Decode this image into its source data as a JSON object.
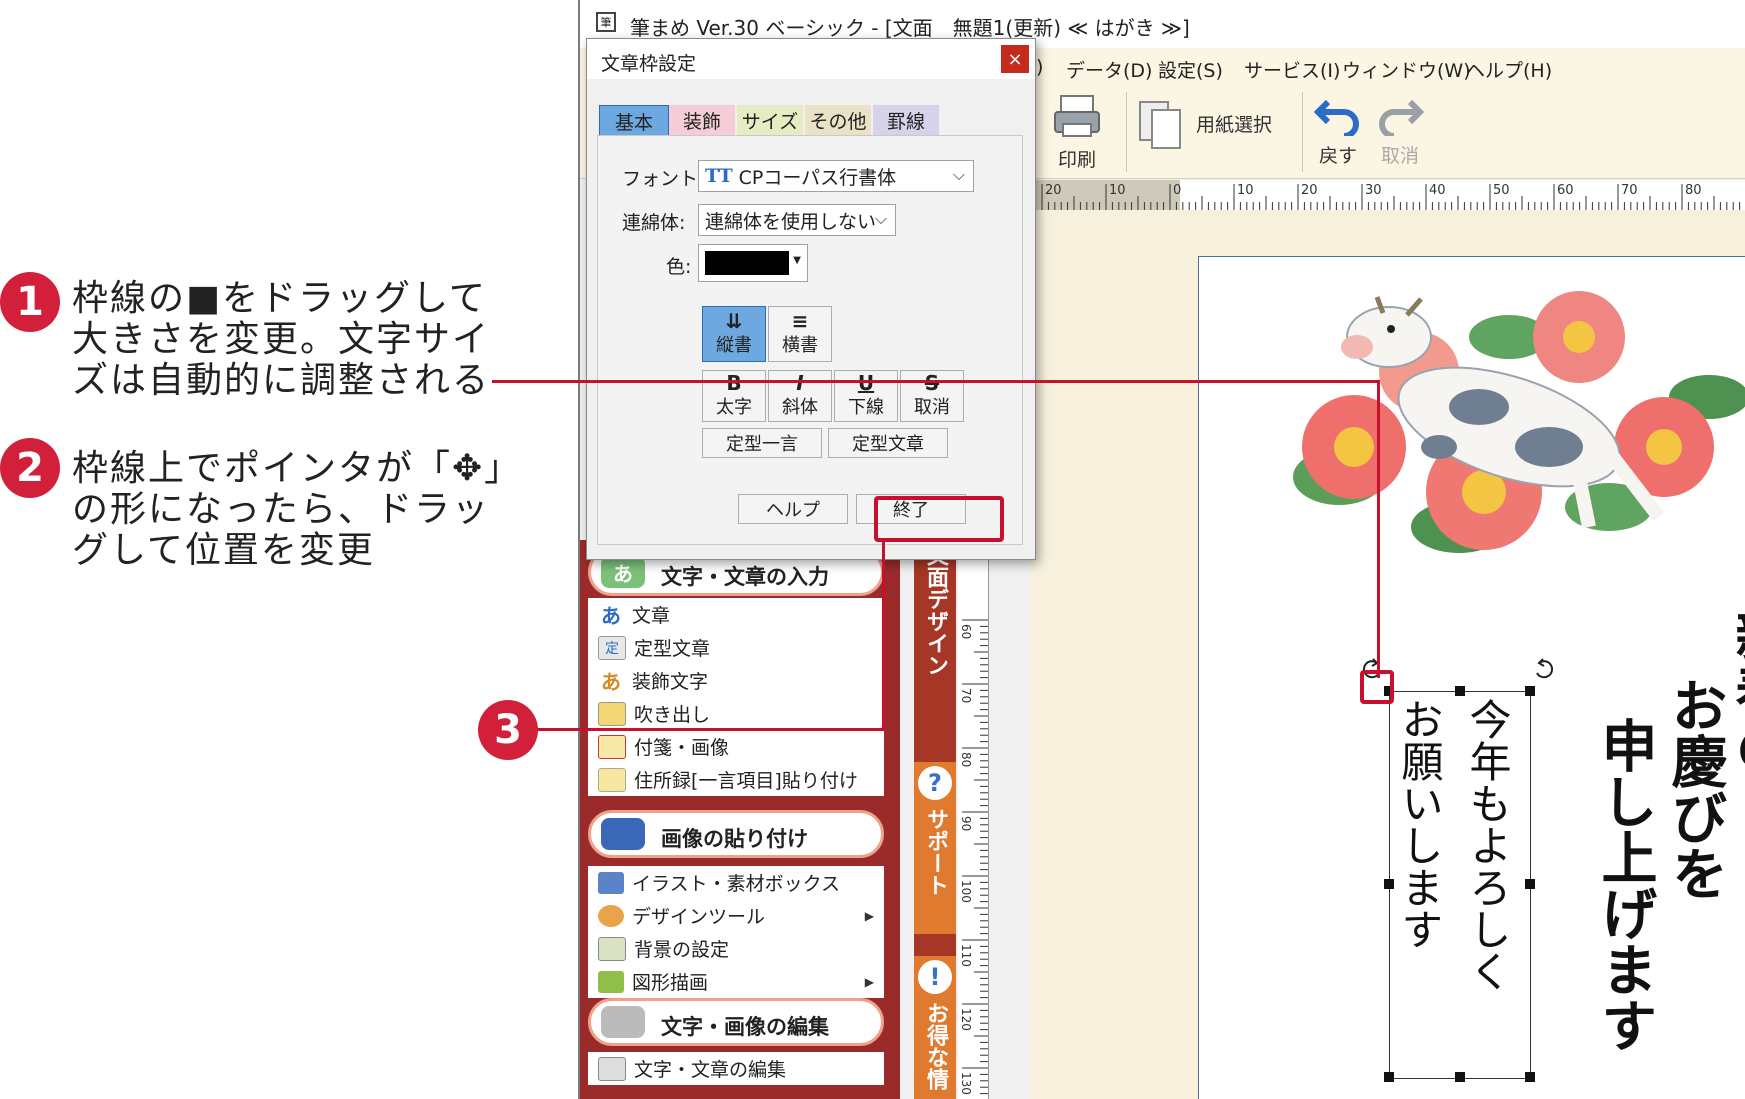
{
  "annotations": {
    "step1": {
      "num": "1",
      "text": "枠線の■をドラッグして\n大きさを変更。文字サイ\nズは自動的に調整される"
    },
    "step2": {
      "num": "2",
      "text": "枠線上でポインタが「✥」\nの形になったら、ドラッ\nグして位置を変更"
    },
    "step3": {
      "num": "3"
    }
  },
  "app": {
    "title": "筆まめ Ver.30 ベーシック - [文面　無題1(更新) ≪ はがき ≫]",
    "menus": [
      "データ(D)",
      "設定(S)",
      "サービス(I)",
      "ウィンドウ(W)",
      "ヘルプ(H)"
    ],
    "menu_fragment": ")",
    "toolbar": {
      "print": "印刷",
      "paper_select": "用紙選択",
      "undo": "戻す",
      "redo": "取消"
    },
    "ruler_top_labels": [
      "20",
      "10",
      "0",
      "10",
      "20",
      "30",
      "40",
      "50",
      "60",
      "70",
      "80"
    ],
    "ruler_left_labels": [
      "60",
      "70",
      "80",
      "90",
      "100",
      "110",
      "120",
      "130"
    ]
  },
  "dialog": {
    "title": "文章枠設定",
    "close": "×",
    "tabs": [
      "基本",
      "装飾",
      "サイズ",
      "その他",
      "罫線"
    ],
    "font_label": "フォント:",
    "font_value": "CPコーパス行書体",
    "font_icon": "TT",
    "ligature_label": "連綿体:",
    "ligature_value": "連綿体を使用しない",
    "color_label": "色:",
    "vertical": "縦書",
    "horizontal": "横書",
    "bold": "太字",
    "italic": "斜体",
    "underline": "下線",
    "strike": "取消",
    "bold_glyph": "B",
    "italic_glyph": "I",
    "underline_glyph": "U",
    "strike_glyph": "S",
    "fixed_phrase": "定型一言",
    "fixed_text": "定型文章",
    "help": "ヘルプ",
    "finish": "終了"
  },
  "side_panel": {
    "section1": {
      "badge": "あ",
      "title": "文字・文章の入力"
    },
    "section1_items": [
      {
        "label": "文章",
        "icon": "あ"
      },
      {
        "label": "定型文章",
        "icon": "定"
      },
      {
        "label": "装飾文字",
        "icon": "あ"
      },
      {
        "label": "吹き出し",
        "icon": ""
      },
      {
        "label": "付箋・画像",
        "icon": ""
      },
      {
        "label": "住所録[一言項目]貼り付け",
        "icon": ""
      }
    ],
    "section2": {
      "title": "画像の貼り付け"
    },
    "section2_items": [
      {
        "label": "イラスト・素材ボックス",
        "icon": ""
      },
      {
        "label": "デザインツール",
        "icon": ""
      },
      {
        "label": "背景の設定",
        "icon": ""
      },
      {
        "label": "図形描画",
        "icon": ""
      }
    ],
    "section3": {
      "title": "文字・画像の編集"
    },
    "section3_items": [
      {
        "label": "文字・文章の編集",
        "icon": ""
      }
    ],
    "tab_design": "文面デザイン",
    "tab_support": "サポート",
    "tab_deals": "お得な情",
    "tab_support_icon": "?",
    "tab_deals_icon": "!"
  },
  "postcard": {
    "main_col1": "申し上げます",
    "main_col2": "お慶びを",
    "main_col3": "新春の",
    "selected_col1": "今年もよろしく",
    "selected_col2": "お願いします"
  },
  "colors": {
    "accent_red": "#c8102e",
    "tab_blue": "#6ea8e0"
  }
}
